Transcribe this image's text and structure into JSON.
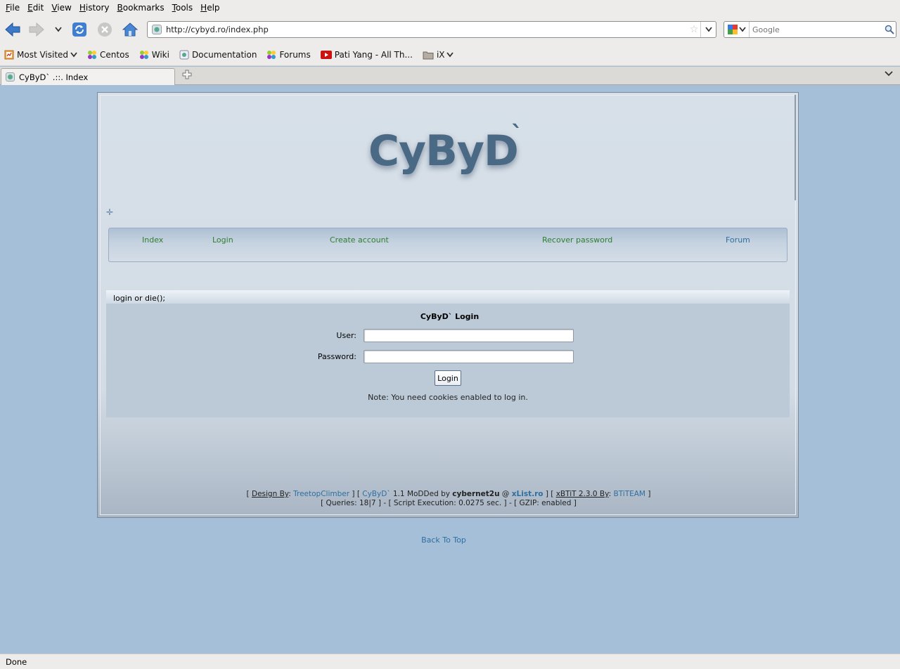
{
  "menubar": {
    "items": [
      "File",
      "Edit",
      "View",
      "History",
      "Bookmarks",
      "Tools",
      "Help"
    ]
  },
  "nav": {
    "url": "http://cybyd.ro/index.php",
    "search_placeholder": "Google"
  },
  "bookmarks": [
    {
      "label": "Most Visited",
      "icon": "most-visited-icon",
      "dropdown": true
    },
    {
      "label": "Centos",
      "icon": "gear-flower-icon"
    },
    {
      "label": "Wiki",
      "icon": "gear-flower-icon"
    },
    {
      "label": "Documentation",
      "icon": "page-icon"
    },
    {
      "label": "Forums",
      "icon": "gear-flower-icon"
    },
    {
      "label": "Pati Yang - All Th...",
      "icon": "youtube-icon"
    },
    {
      "label": "iX",
      "icon": "folder-icon",
      "dropdown": true
    }
  ],
  "tab": {
    "title": "CyByD` .::. Index"
  },
  "status": "Done",
  "page": {
    "logo": "CyByD",
    "logo_tick": "`",
    "menu": {
      "index": "Index",
      "login": "Login",
      "create_account": "Create account",
      "recover_password": "Recover password",
      "forum": "Forum"
    },
    "panel_title": "login or die();",
    "login_title": "CyByD` Login",
    "user_label": "User:",
    "password_label": "Password:",
    "user_value": "",
    "password_value": "",
    "login_button": "Login",
    "note": "Note: You need cookies enabled to log in.",
    "footer": {
      "open1": "[ ",
      "design_by": "Design By",
      "colon": ": ",
      "designer": "TreetopClimber",
      "sep1": " ]  [ ",
      "site": "CyByD`",
      "modded": " 1.1 MoDDed by ",
      "author": "cybernet2u",
      "at": " @ ",
      "xlist": "xList.ro",
      "sep2": " ] [ ",
      "xbtit": "xBTiT 2.3.0 By",
      "colon2": ": ",
      "btiteam": "BTiTEAM",
      "close": " ]",
      "line2": "[ Queries: 18|7 ] - [ Script Execution: 0.0275 sec. ] - [ GZIP: enabled ]"
    },
    "back_to_top": "Back To Top"
  },
  "colors": {
    "page_bg": "#a5bfd8",
    "link_green": "#2e7f2e",
    "link_blue": "#2f6f9f",
    "logo": "#4a6985"
  }
}
